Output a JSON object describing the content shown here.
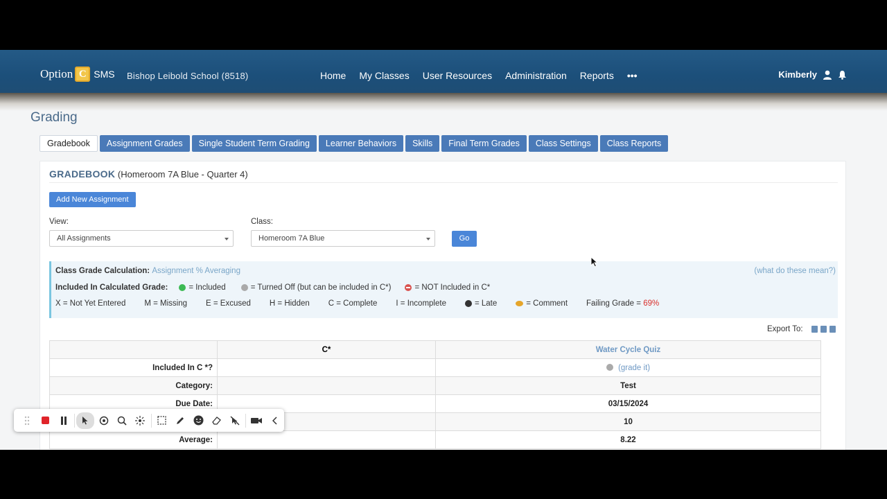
{
  "header": {
    "logo_text": "Option",
    "logo_mark": "C",
    "logo_suffix": "SMS",
    "school": "Bishop Leibold School  (8518)",
    "nav": [
      "Home",
      "My Classes",
      "User Resources",
      "Administration",
      "Reports",
      "•••"
    ],
    "user_name": "Kimberly"
  },
  "page": {
    "title": "Grading",
    "tabs": [
      "Gradebook",
      "Assignment Grades",
      "Single Student Term Grading",
      "Learner Behaviors",
      "Skills",
      "Final Term Grades",
      "Class Settings",
      "Class Reports"
    ],
    "active_tab": "Gradebook"
  },
  "gradebook": {
    "heading": "GRADEBOOK",
    "subheading": "(Homeroom 7A Blue - Quarter 4)",
    "add_button": "Add New Assignment",
    "view_label": "View:",
    "view_value": "All Assignments",
    "class_label": "Class:",
    "class_value": "Homeroom 7A Blue",
    "go_button": "Go"
  },
  "legend": {
    "calc_label": "Class Grade Calculation:",
    "calc_value": "Assignment % Averaging",
    "help_link": "(what do these mean?)",
    "included_label": "Included In Calculated Grade:",
    "included": "= Included",
    "turned_off": "= Turned Off (but can be included in C*)",
    "not_included": "= NOT Included in C*",
    "codes": [
      "X = Not Yet Entered",
      "M = Missing",
      "E = Excused",
      "H = Hidden",
      "C = Complete",
      "I = Incomplete"
    ],
    "late": "= Late",
    "comment": "= Comment",
    "failing_label": "Failing Grade =",
    "failing_value": "69%",
    "failing_color": "#d9302c"
  },
  "export_label": "Export To:",
  "table": {
    "header_c": "C*",
    "assignment": "Water Cycle Quiz",
    "rows": [
      {
        "label": "Included In C *?",
        "value": "(grade it)"
      },
      {
        "label": "Category:",
        "value": "Test"
      },
      {
        "label": "Due Date:",
        "value": "03/15/2024"
      },
      {
        "label": "",
        "value": "10"
      },
      {
        "label": "Average:",
        "value": "8.22"
      }
    ]
  },
  "recorder": {
    "tools": [
      "drag-handle-icon",
      "record-stop-icon",
      "pause-icon",
      "pointer-icon",
      "spotlight-icon",
      "zoom-icon",
      "laser-icon",
      "select-region-icon",
      "pen-icon",
      "emoji-icon",
      "eraser-icon",
      "hide-pointer-icon",
      "camera-icon",
      "collapse-icon"
    ]
  }
}
